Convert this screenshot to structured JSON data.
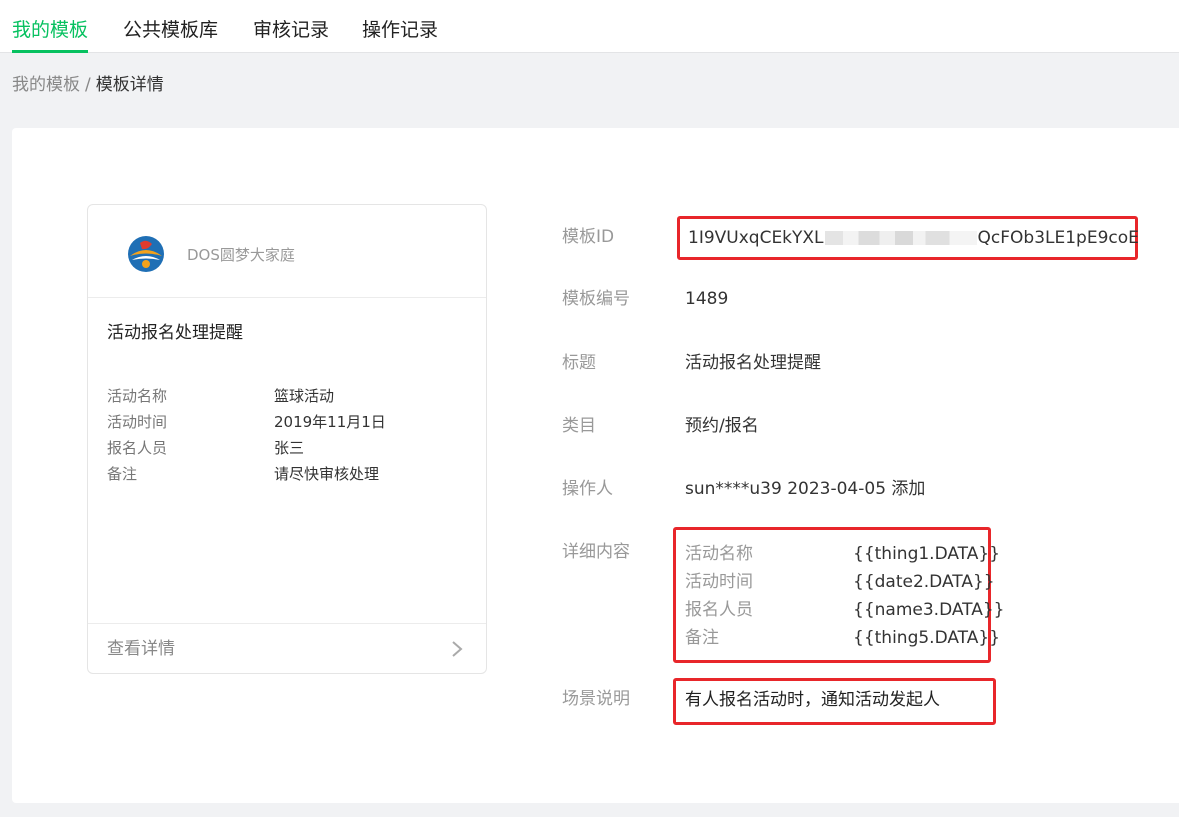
{
  "tabs": [
    {
      "label": "我的模板",
      "active": true
    },
    {
      "label": "公共模板库",
      "active": false
    },
    {
      "label": "审核记录",
      "active": false
    },
    {
      "label": "操作记录",
      "active": false
    }
  ],
  "breadcrumb": {
    "parent": "我的模板",
    "separator": "/",
    "current": "模板详情"
  },
  "preview_card": {
    "brand_name": "DOS圆梦大家庭",
    "title": "活动报名处理提醒",
    "rows": [
      {
        "label": "活动名称",
        "value": "篮球活动"
      },
      {
        "label": "活动时间",
        "value": "2019年11月1日"
      },
      {
        "label": "报名人员",
        "value": "张三"
      },
      {
        "label": "备注",
        "value": "请尽快审核处理"
      }
    ],
    "footer_link": "查看详情"
  },
  "details": {
    "id": {
      "label": "模板ID",
      "prefix": "1I9VUxqCEkYXL",
      "suffix": "QcFOb3LE1pE9coE"
    },
    "number": {
      "label": "模板编号",
      "value": "1489"
    },
    "title": {
      "label": "标题",
      "value": "活动报名处理提醒"
    },
    "category": {
      "label": "类目",
      "value": "预约/报名"
    },
    "operator": {
      "label": "操作人",
      "value": "sun****u39 2023-04-05 添加"
    },
    "content": {
      "label": "详细内容",
      "rows": [
        {
          "label": "活动名称",
          "value": "{{thing1.DATA}}"
        },
        {
          "label": "活动时间",
          "value": "{{date2.DATA}}"
        },
        {
          "label": "报名人员",
          "value": "{{name3.DATA}}"
        },
        {
          "label": "备注",
          "value": "{{thing5.DATA}}"
        }
      ]
    },
    "scene": {
      "label": "场景说明",
      "value": "有人报名活动时，通知活动发起人"
    }
  },
  "colors": {
    "accent": "#07c160",
    "highlight_border": "#e8262a"
  }
}
